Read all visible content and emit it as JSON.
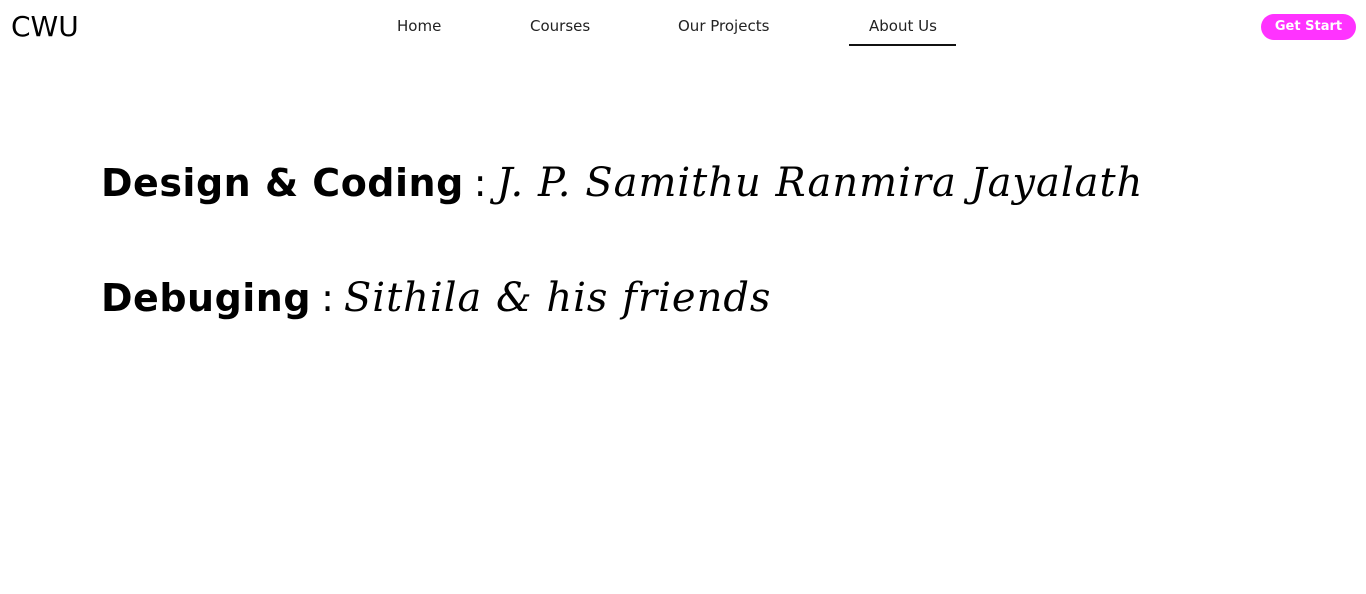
{
  "header": {
    "logo": "CWU",
    "nav": {
      "home": "Home",
      "courses": "Courses",
      "projects": "Our Projects",
      "about": "About Us"
    },
    "active_tab": "About Us",
    "cta_label": "Get Start",
    "cta_color": "#ff33ff"
  },
  "credits": [
    {
      "role": "Design & Coding",
      "separator": ":",
      "name": "J. P. Samithu Ranmira Jayalath"
    },
    {
      "role": "Debuging",
      "separator": ":",
      "name": "Sithila & his friends"
    }
  ]
}
